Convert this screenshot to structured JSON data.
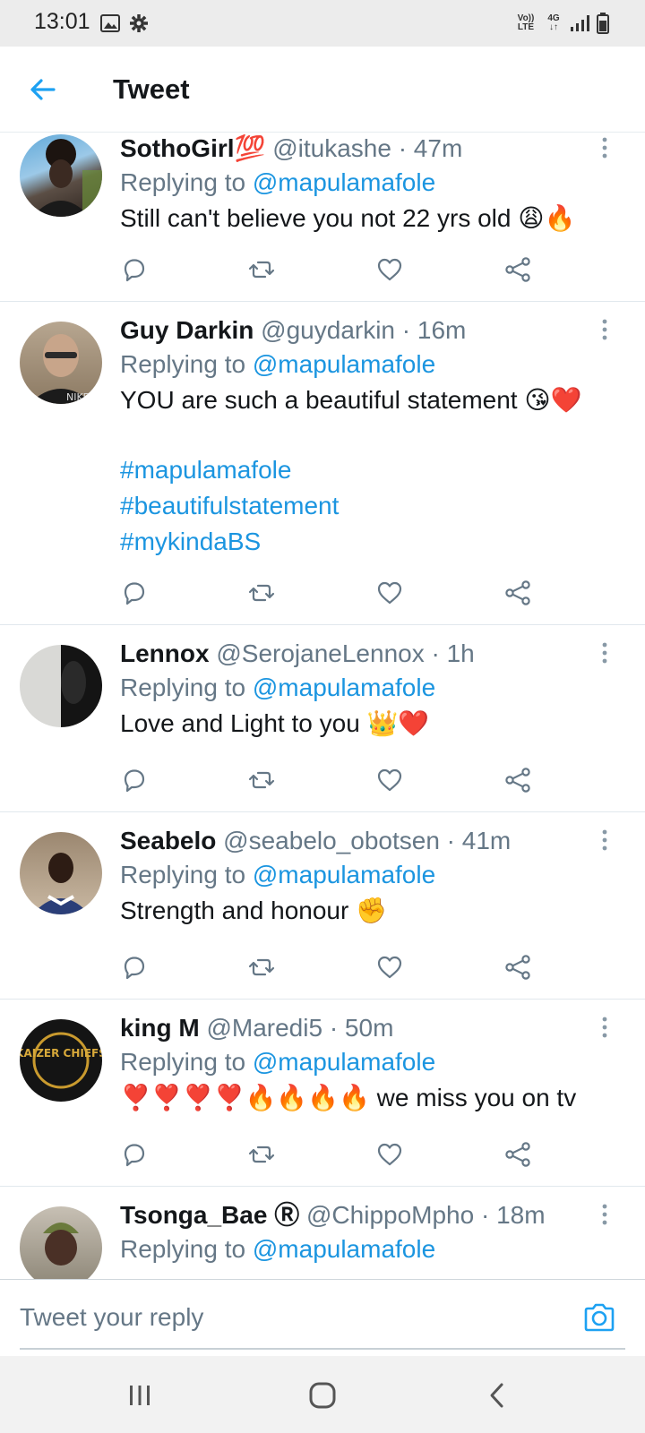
{
  "status_bar": {
    "time": "13:01",
    "network_volte": "Vo)) LTE",
    "network_type": "4G"
  },
  "header": {
    "title": "Tweet"
  },
  "tweets": [
    {
      "name": "SothoGirl💯",
      "handle": "@itukashe",
      "time": "· 47m",
      "replying_prefix": "Replying to ",
      "replying_to": "@mapulamafole",
      "text": "Still can't believe you not 22 yrs old 😩🔥",
      "hashtags": []
    },
    {
      "name": "Guy Darkin",
      "handle": "@guydarkin",
      "time": "· 16m",
      "replying_prefix": "Replying to ",
      "replying_to": "@mapulamafole",
      "text": "YOU are such a beautiful statement 😘❤️",
      "hashtags": [
        "#mapulamafole",
        "#beautifulstatement",
        "#mykindaBS"
      ]
    },
    {
      "name": "Lennox",
      "handle": "@SerojaneLennox",
      "time": "· 1h",
      "replying_prefix": "Replying to ",
      "replying_to": "@mapulamafole",
      "text": "Love and Light to you 👑❤️",
      "hashtags": []
    },
    {
      "name": "Seabelo",
      "handle": "@seabelo_obotsen",
      "time": "· 41m",
      "replying_prefix": "Replying to ",
      "replying_to": "@mapulamafole",
      "text": "Strength and honour ✊",
      "hashtags": []
    },
    {
      "name": "king M",
      "handle": "@Maredi5",
      "time": "· 50m",
      "replying_prefix": "Replying to ",
      "replying_to": "@mapulamafole",
      "text": "❣️❣️❣️❣️🔥🔥🔥🔥 we miss you on tv",
      "hashtags": []
    },
    {
      "name": "Tsonga_Bae",
      "name_suffix": "Ⓡ",
      "handle": "@ChippoMpho",
      "time": "· 18m",
      "replying_prefix": "Replying to ",
      "replying_to": "@mapulamafole",
      "text": "",
      "hashtags": []
    }
  ],
  "avatar_logo_text": "KAIZER CHIEFS",
  "reply_bar": {
    "placeholder": "Tweet your reply"
  },
  "icons": {
    "back": "arrow-left-icon",
    "more": "more-vertical-icon",
    "reply": "reply-icon",
    "retweet": "retweet-icon",
    "like": "heart-icon",
    "share": "share-icon",
    "camera": "camera-icon"
  },
  "colors": {
    "accent": "#1da1f2",
    "link": "#1b95e0",
    "secondary_text": "#657786",
    "divider": "#e1e8ed"
  }
}
